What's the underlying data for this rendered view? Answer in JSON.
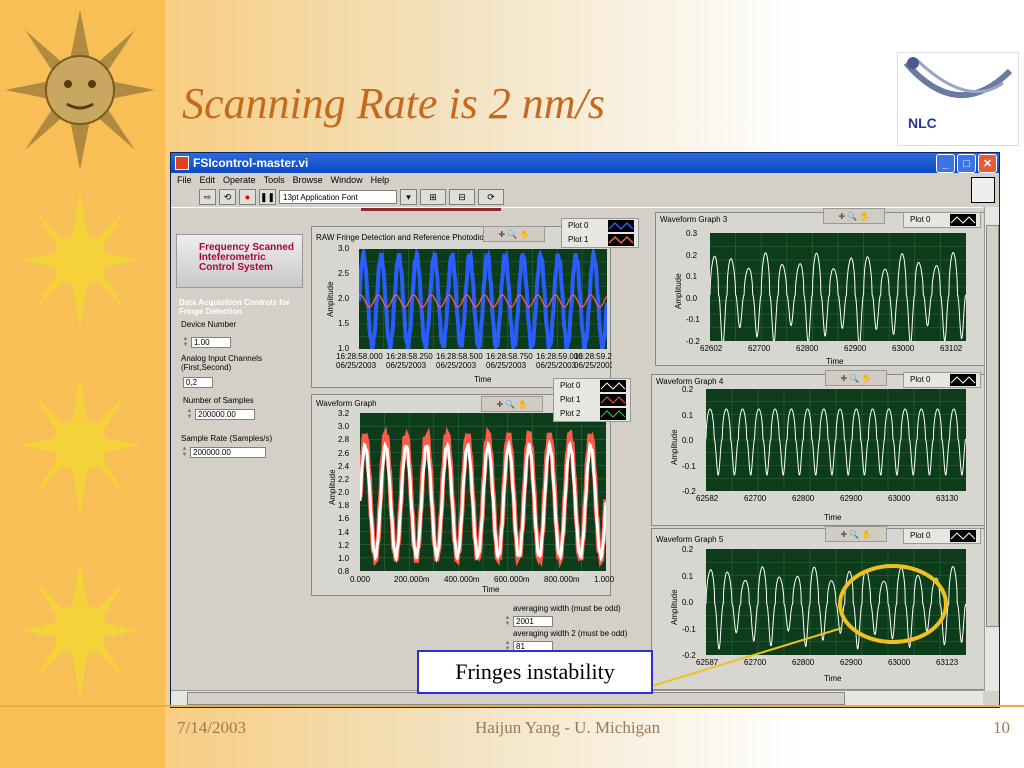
{
  "slide": {
    "title": "Scanning Rate is 2 nm/s",
    "date": "7/14/2003",
    "author": "Haijun Yang -  U.  Michigan",
    "page": "10",
    "logo": "NLC",
    "annotation": "Fringes instability",
    "accent": "#c46a1e"
  },
  "window": {
    "title": "FSIcontrol-master.vi",
    "menu": [
      "File",
      "Edit",
      "Operate",
      "Tools",
      "Browse",
      "Window",
      "Help"
    ],
    "font_selector": "13pt Application Font"
  },
  "nav": {
    "title": "Frequency Scanned Inteferometric Control System"
  },
  "controls": {
    "heading": "Data Acquisition Controls for Fringe Detection",
    "device_label": "Device Number",
    "device_value": "1.00",
    "channels_label": "Analog Input Channels (First,Second)",
    "channels_value": "0,2",
    "samples_label": "Number of Samples",
    "samples_value": "200000.00",
    "rate_label": "Sample Rate (Samples/s)",
    "rate_value": "200000.00",
    "avg1_label": "averaging width (must be odd)",
    "avg1_value": "2001",
    "avg2_label": "averaging width 2 (must be odd)",
    "avg2_value": "81"
  },
  "graphs": {
    "raw": {
      "title": "RAW Fringe Detection  and Reference Photodiode Measurement",
      "ylabel": "Amplitude",
      "xlabel": "Time",
      "yticks": [
        "3.0",
        "2.5",
        "2.0",
        "1.5",
        "1.0"
      ],
      "xticks": [
        "16:28:58.000\n06/25/2003",
        "16:28:58.250\n06/25/2003",
        "16:28:58.500\n06/25/2003",
        "16:28:58.750\n06/25/2003",
        "16:28:59.000\n06/25/2003",
        "16:28:59.250\n06/25/2003"
      ],
      "legend": [
        "Plot 0",
        "Plot 1"
      ]
    },
    "wave": {
      "title": "Waveform Graph",
      "ylabel": "Amplitude",
      "xlabel": "Time",
      "yticks": [
        "3.2",
        "3.0",
        "2.8",
        "2.6",
        "2.4",
        "2.2",
        "2.0",
        "1.8",
        "1.6",
        "1.4",
        "1.2",
        "1.0",
        "0.8"
      ],
      "xticks": [
        "0.000",
        "200.000m",
        "400.000m",
        "600.000m",
        "800.000m",
        "1.000"
      ],
      "legend": [
        "Plot 0",
        "Plot 1",
        "Plot 2"
      ]
    },
    "w3": {
      "title": "Waveform Graph 3",
      "ylabel": "Amplitude",
      "xlabel": "Time",
      "legend": "Plot 0",
      "yticks": [
        "0.3",
        "0.2",
        "0.1",
        "0.0",
        "-0.1",
        "-0.2"
      ],
      "xticks": [
        "62602",
        "62700",
        "62800",
        "62900",
        "63000",
        "63102"
      ]
    },
    "w4": {
      "title": "Waveform Graph 4",
      "ylabel": "Amplitude",
      "xlabel": "Time",
      "legend": "Plot 0",
      "yticks": [
        "0.2",
        "0.1",
        "0.0",
        "-0.1",
        "-0.2"
      ],
      "xticks": [
        "62582",
        "62700",
        "62800",
        "62900",
        "63000",
        "63130"
      ]
    },
    "w5": {
      "title": "Waveform Graph 5",
      "ylabel": "Amplitude",
      "xlabel": "Time",
      "legend": "Plot 0",
      "yticks": [
        "0.2",
        "0.1",
        "0.0",
        "-0.1",
        "-0.2"
      ],
      "xticks": [
        "62587",
        "62700",
        "62800",
        "62900",
        "63000",
        "63123"
      ]
    }
  },
  "colors": {
    "plot_bg": "#0c3c1a",
    "grid": "#2f6a3a",
    "blue": "#2a5cff",
    "red": "#ff5a4a",
    "white": "#ffffff",
    "highlight": "#f0c020"
  }
}
